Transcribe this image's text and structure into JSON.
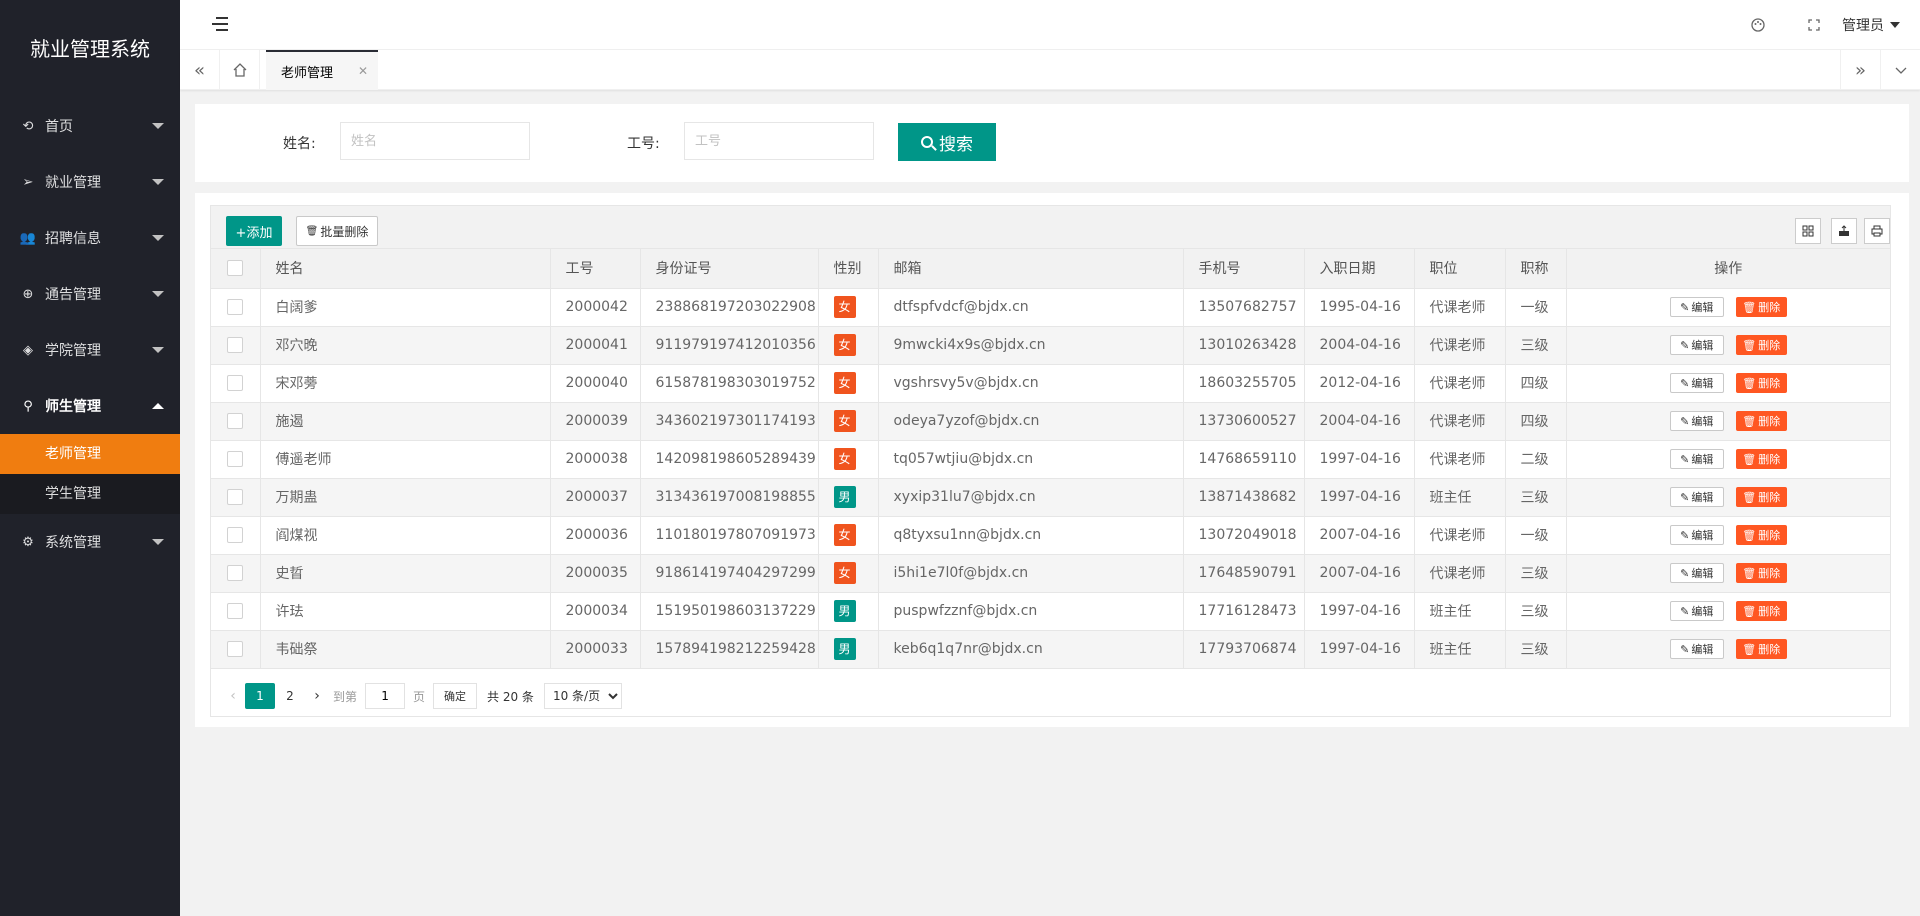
{
  "app": {
    "title": "就业管理系统"
  },
  "sidebar": {
    "items": [
      {
        "label": "首页",
        "icon": "home-icon"
      },
      {
        "label": "就业管理",
        "icon": "send-icon"
      },
      {
        "label": "招聘信息",
        "icon": "users-icon"
      },
      {
        "label": "通告管理",
        "icon": "globe-icon"
      },
      {
        "label": "学院管理",
        "icon": "layers-icon"
      },
      {
        "label": "师生管理",
        "icon": "user-icon",
        "open": true,
        "children": [
          {
            "label": "老师管理",
            "active": true
          },
          {
            "label": "学生管理"
          }
        ]
      },
      {
        "label": "系统管理",
        "icon": "gear-icon"
      }
    ]
  },
  "header": {
    "user": "管理员"
  },
  "tabs": [
    {
      "label": "老师管理",
      "active": true
    }
  ],
  "search": {
    "name_label": "姓名:",
    "name_placeholder": "姓名",
    "id_label": "工号:",
    "id_placeholder": "工号",
    "button": "搜索"
  },
  "toolbar": {
    "add": "+添加",
    "batch_delete": "批量删除"
  },
  "table": {
    "columns": [
      "姓名",
      "工号",
      "身份证号",
      "性别",
      "邮箱",
      "手机号",
      "入职日期",
      "职位",
      "职称",
      "操作"
    ],
    "rows": [
      {
        "name": "白阔爹",
        "id": "2000042",
        "idcard": "238868197203022908",
        "sex": "女",
        "email": "dtfspfvdcf@bjdx.cn",
        "phone": "13507682757",
        "date": "1995-04-16",
        "position": "代课老师",
        "title": "一级"
      },
      {
        "name": "邓穴晚",
        "id": "2000041",
        "idcard": "911979197412010356",
        "sex": "女",
        "email": "9mwcki4x9s@bjdx.cn",
        "phone": "13010263428",
        "date": "2004-04-16",
        "position": "代课老师",
        "title": "三级"
      },
      {
        "name": "宋邓蒡",
        "id": "2000040",
        "idcard": "615878198303019752",
        "sex": "女",
        "email": "vgshrsvy5v@bjdx.cn",
        "phone": "18603255705",
        "date": "2012-04-16",
        "position": "代课老师",
        "title": "四级"
      },
      {
        "name": "施遏",
        "id": "2000039",
        "idcard": "343602197301174193",
        "sex": "女",
        "email": "odeya7yzof@bjdx.cn",
        "phone": "13730600527",
        "date": "2004-04-16",
        "position": "代课老师",
        "title": "四级"
      },
      {
        "name": "傅遥老师",
        "id": "2000038",
        "idcard": "142098198605289439",
        "sex": "女",
        "email": "tq057wtjiu@bjdx.cn",
        "phone": "14768659110",
        "date": "1997-04-16",
        "position": "代课老师",
        "title": "二级"
      },
      {
        "name": "万期蛊",
        "id": "2000037",
        "idcard": "313436197008198855",
        "sex": "男",
        "email": "xyxip31lu7@bjdx.cn",
        "phone": "13871438682",
        "date": "1997-04-16",
        "position": "班主任",
        "title": "三级"
      },
      {
        "name": "阎煤视",
        "id": "2000036",
        "idcard": "110180197807091973",
        "sex": "女",
        "email": "q8tyxsu1nn@bjdx.cn",
        "phone": "13072049018",
        "date": "2007-04-16",
        "position": "代课老师",
        "title": "一级"
      },
      {
        "name": "史晢",
        "id": "2000035",
        "idcard": "918614197404297299",
        "sex": "女",
        "email": "i5hi1e7l0f@bjdx.cn",
        "phone": "17648590791",
        "date": "2007-04-16",
        "position": "代课老师",
        "title": "三级"
      },
      {
        "name": "许珐",
        "id": "2000034",
        "idcard": "151950198603137229",
        "sex": "男",
        "email": "puspwfzznf@bjdx.cn",
        "phone": "17716128473",
        "date": "1997-04-16",
        "position": "班主任",
        "title": "三级"
      },
      {
        "name": "韦础祭",
        "id": "2000033",
        "idcard": "157894198212259428",
        "sex": "男",
        "email": "keb6q1q7nr@bjdx.cn",
        "phone": "17793706874",
        "date": "1997-04-16",
        "position": "班主任",
        "title": "三级"
      }
    ],
    "edit_label": "编辑",
    "delete_label": "删除"
  },
  "pagination": {
    "pages": [
      "1",
      "2"
    ],
    "current": "1",
    "goto_label": "到第",
    "goto_value": "1",
    "page_unit": "页",
    "confirm": "确定",
    "total": "共 20 条",
    "page_size": "10 条/页"
  },
  "colors": {
    "primary": "#009688",
    "accent": "#f07d10",
    "danger": "#ff5722",
    "female": "#f0541e",
    "sidebar_bg": "#20222a"
  }
}
